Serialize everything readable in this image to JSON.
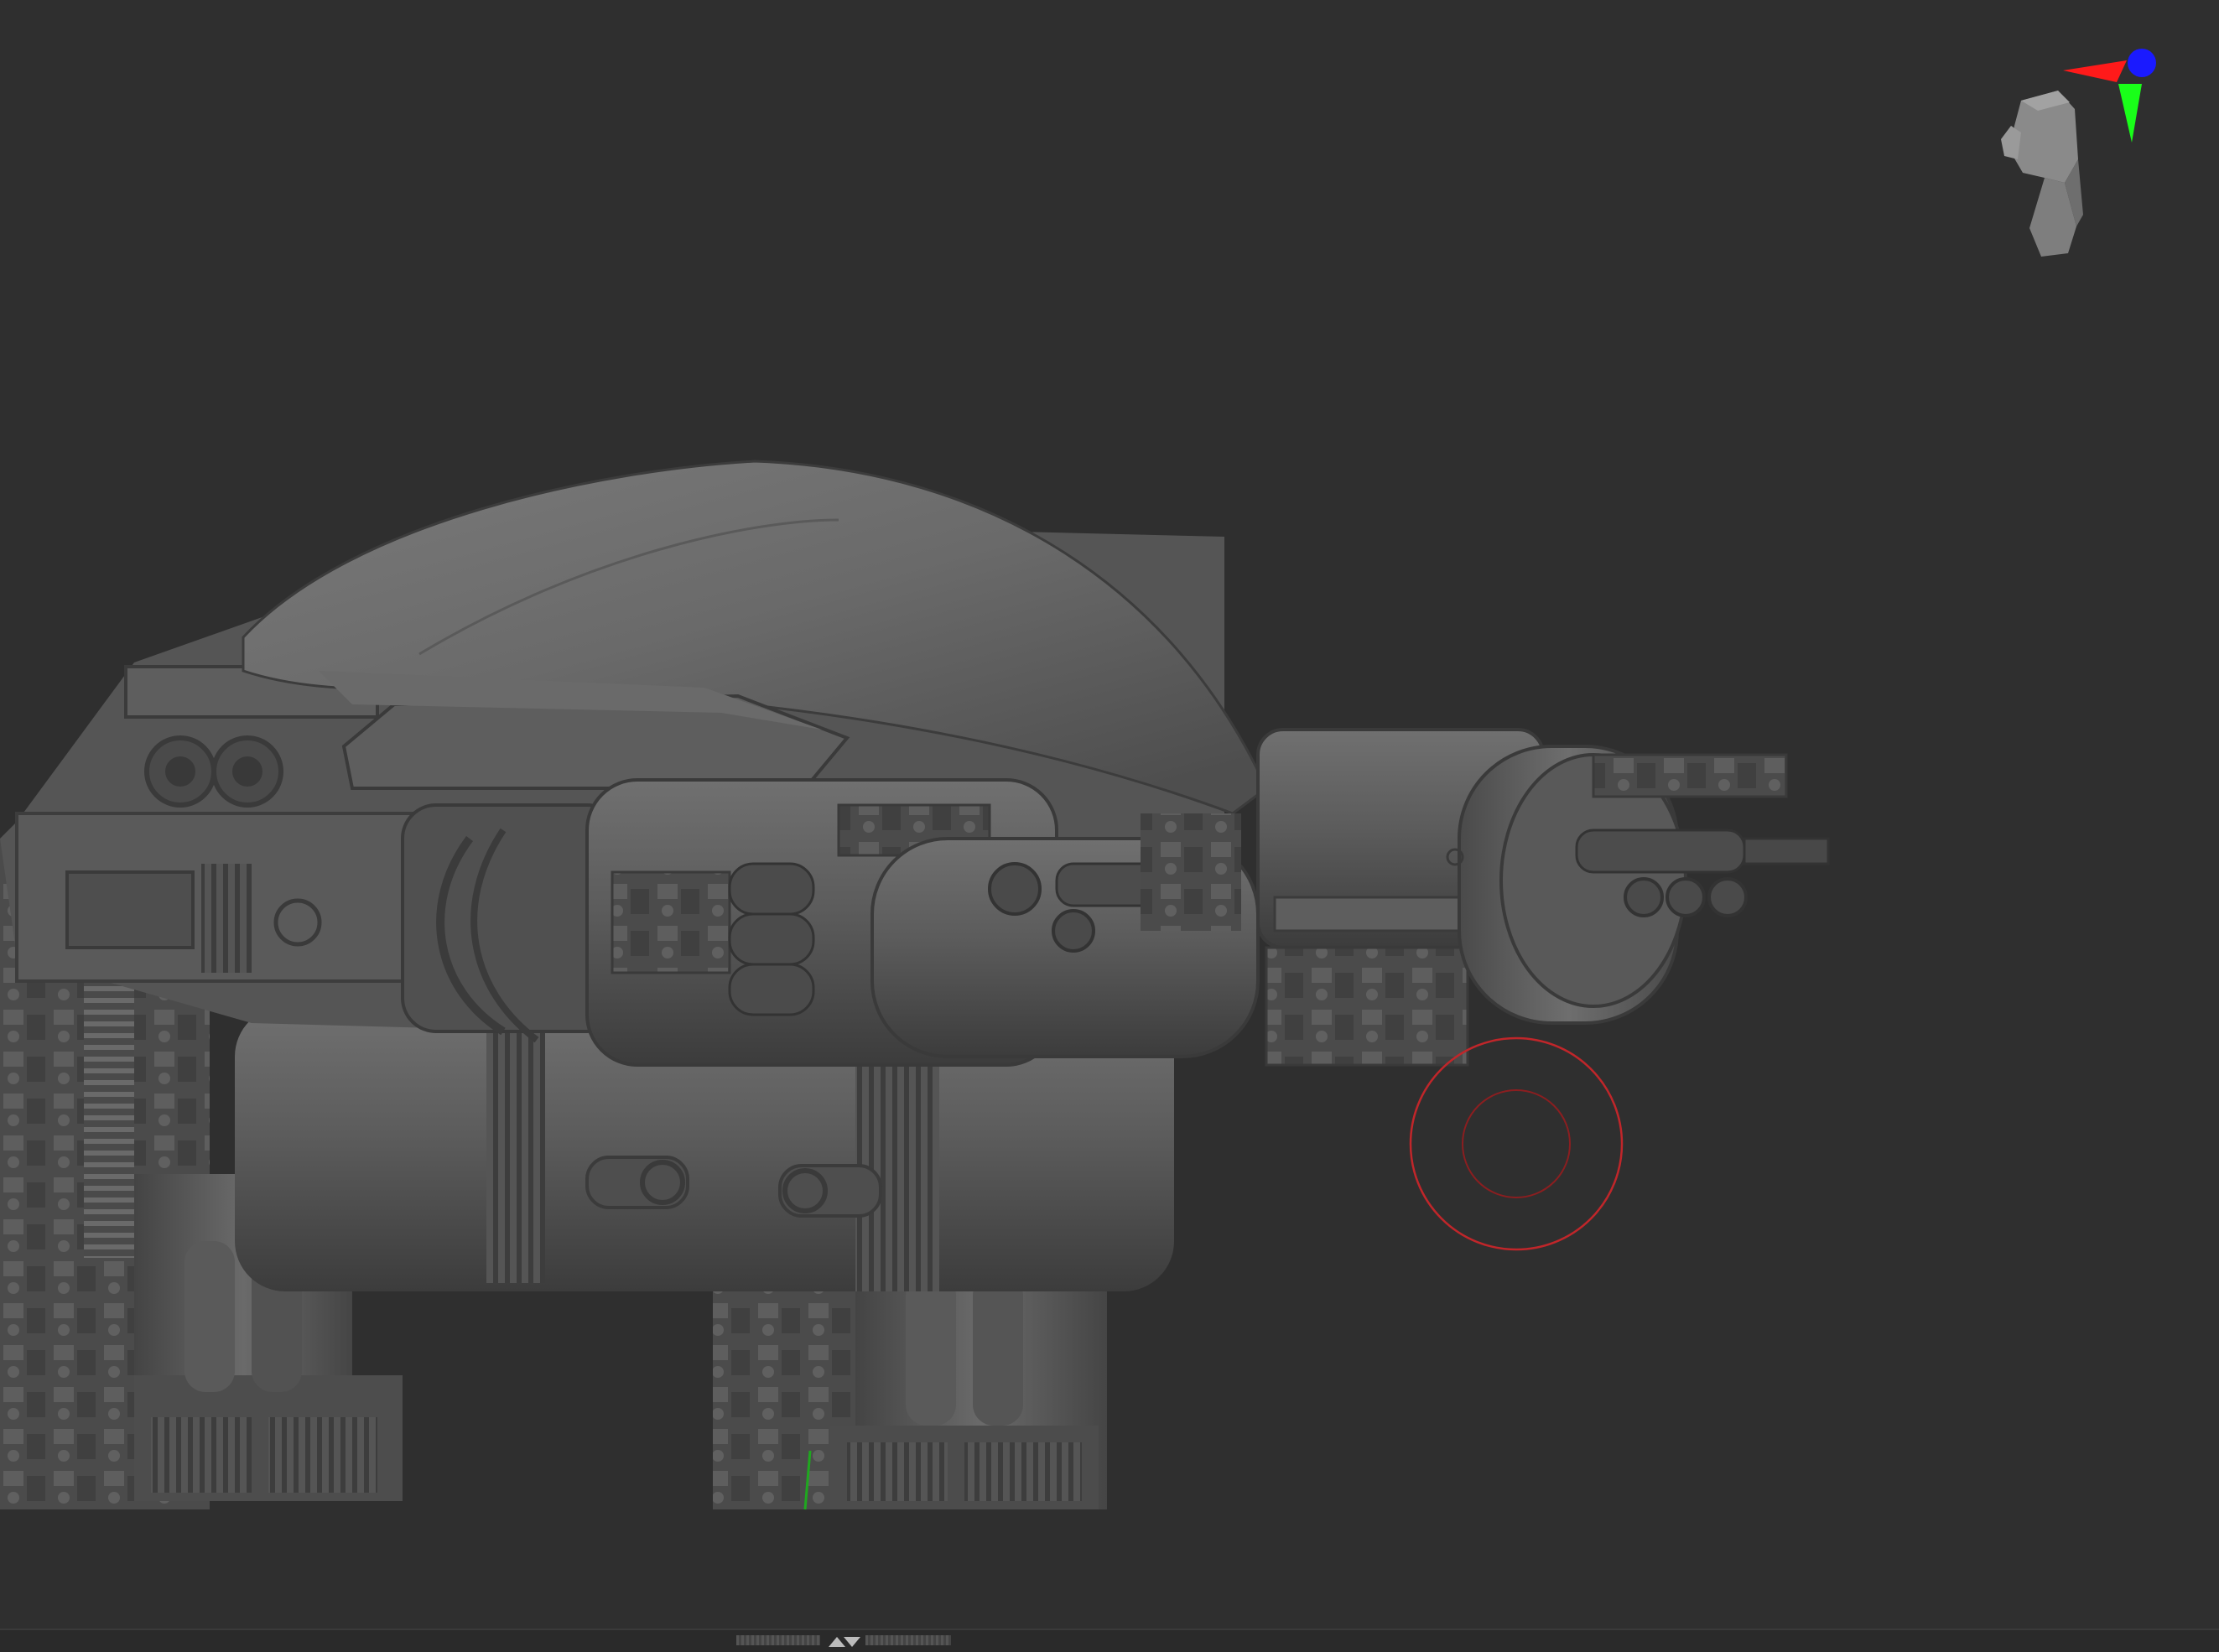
{
  "viewport": {
    "background": "#2f2f2f",
    "model": "robot-mech-sculpt",
    "render_style": "matcap-grey"
  },
  "gizmo": {
    "icon": "head-orientation-icon",
    "axes": [
      {
        "name": "x",
        "color": "#ff1a1a"
      },
      {
        "name": "y",
        "color": "#19ff19"
      },
      {
        "name": "z",
        "color": "#1a1aff"
      }
    ]
  },
  "brush": {
    "icon": "brush-cursor-icon",
    "color": "#c0262a"
  },
  "tray": {
    "icon": "tray-toggle-icon"
  }
}
